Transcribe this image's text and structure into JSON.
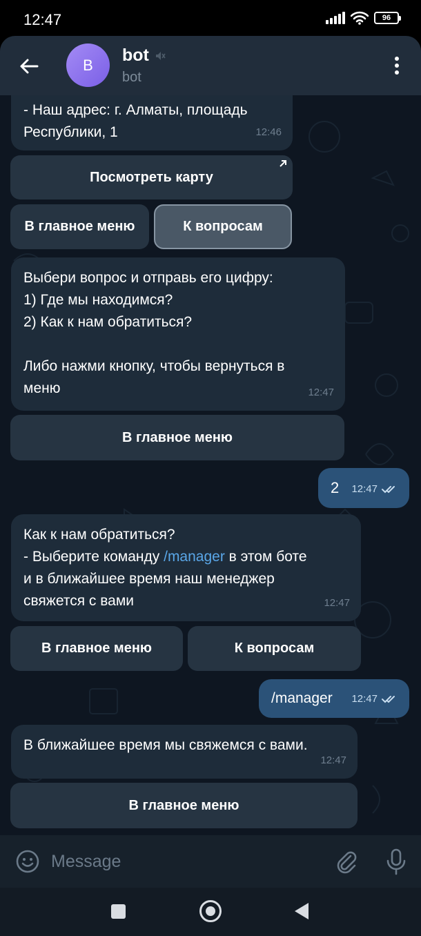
{
  "status_bar": {
    "time": "12:47",
    "battery": "96"
  },
  "header": {
    "avatar_letter": "B",
    "title": "bot",
    "subtitle": "bot"
  },
  "messages": [
    {
      "lines": [
        "- Наш адрес: г. Алматы, площадь",
        "Республики, 1"
      ],
      "time": "12:46"
    },
    {
      "lines": [
        "Выбери вопрос и отправь его цифру:",
        "1) Где мы находимся?",
        "2) Как к нам обратиться?",
        "",
        "Либо нажми кнопку, чтобы вернуться в",
        "меню"
      ],
      "time": "12:47"
    },
    {
      "text": "2",
      "time": "12:47"
    },
    {
      "line1": "Как к нам обратиться?",
      "line2_prefix": "- Выберите команду ",
      "line2_link": "/manager",
      "line2_suffix": " в этом боте",
      "line3": "и в ближайшее время наш менеджер",
      "line4": "свяжется с вами",
      "time": "12:47"
    },
    {
      "text": "/manager",
      "time": "12:47"
    },
    {
      "lines": [
        "В ближайшее время мы свяжемся с вами."
      ],
      "time": "12:47"
    }
  ],
  "keyboards": {
    "kb1": {
      "view_map": "Посмотреть карту",
      "main_menu": "В главное меню",
      "to_questions": "К вопросам"
    },
    "kb2": {
      "main_menu": "В главное меню"
    },
    "kb3": {
      "main_menu": "В главное меню",
      "to_questions": "К вопросам"
    },
    "kb4": {
      "main_menu": "В главное меню"
    }
  },
  "input": {
    "placeholder": "Message"
  },
  "colors": {
    "accent": "#5aa7e8",
    "outgoing_bubble": "#2b5278",
    "incoming_bubble": "#1e2c3a",
    "avatar": "#8c72ee"
  }
}
